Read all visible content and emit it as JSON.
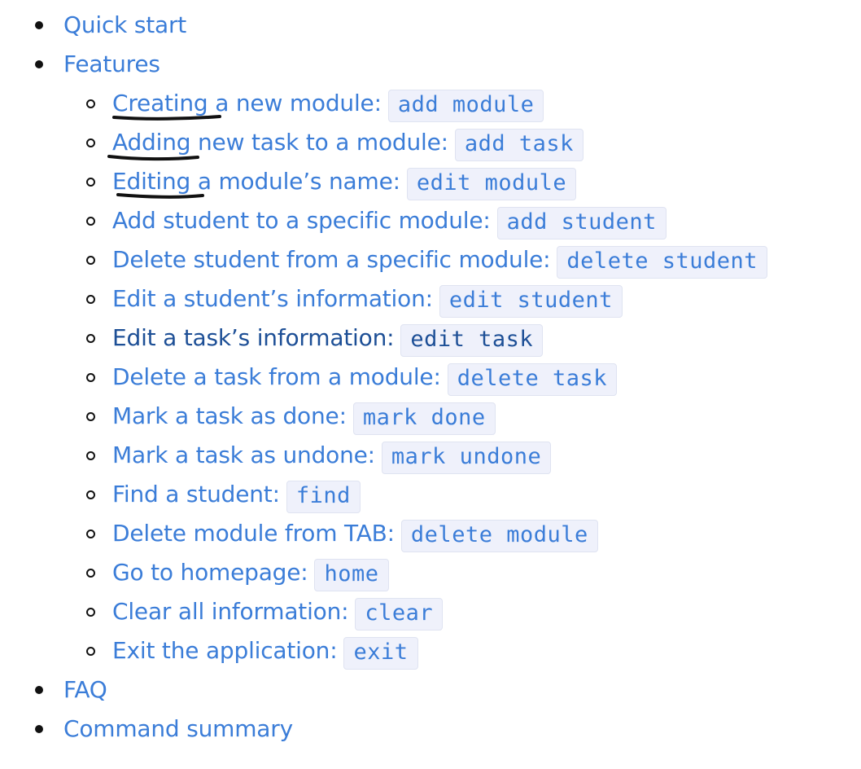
{
  "toc": {
    "quick_start": "Quick start",
    "features": {
      "label": "Features",
      "items": [
        {
          "label": "Creating a new module:",
          "command": "add module"
        },
        {
          "label": "Adding new task to a module:",
          "command": "add task"
        },
        {
          "label": "Editing a module’s name:",
          "command": "edit module"
        },
        {
          "label": "Add student to a specific module:",
          "command": "add student"
        },
        {
          "label": "Delete student from a specific module:",
          "command": "delete student"
        },
        {
          "label": "Edit a student’s information:",
          "command": "edit student"
        },
        {
          "label": "Edit a task’s information:",
          "command": "edit task"
        },
        {
          "label": "Delete a task from a module:",
          "command": "delete task"
        },
        {
          "label": "Mark a task as done:",
          "command": "mark done"
        },
        {
          "label": "Mark a task as undone:",
          "command": "mark undone"
        },
        {
          "label": "Find a student:",
          "command": "find"
        },
        {
          "label": "Delete module from TAB:",
          "command": "delete module"
        },
        {
          "label": "Go to homepage:",
          "command": "home"
        },
        {
          "label": "Clear all information:",
          "command": "clear"
        },
        {
          "label": "Exit the application:",
          "command": "exit"
        }
      ]
    },
    "faq": "FAQ",
    "command_summary": "Command summary"
  },
  "colors": {
    "link": "#3b7dd8",
    "visited_link": "#1d4f96",
    "code_background": "#eff1fb",
    "annotation_ink": "#111111"
  }
}
